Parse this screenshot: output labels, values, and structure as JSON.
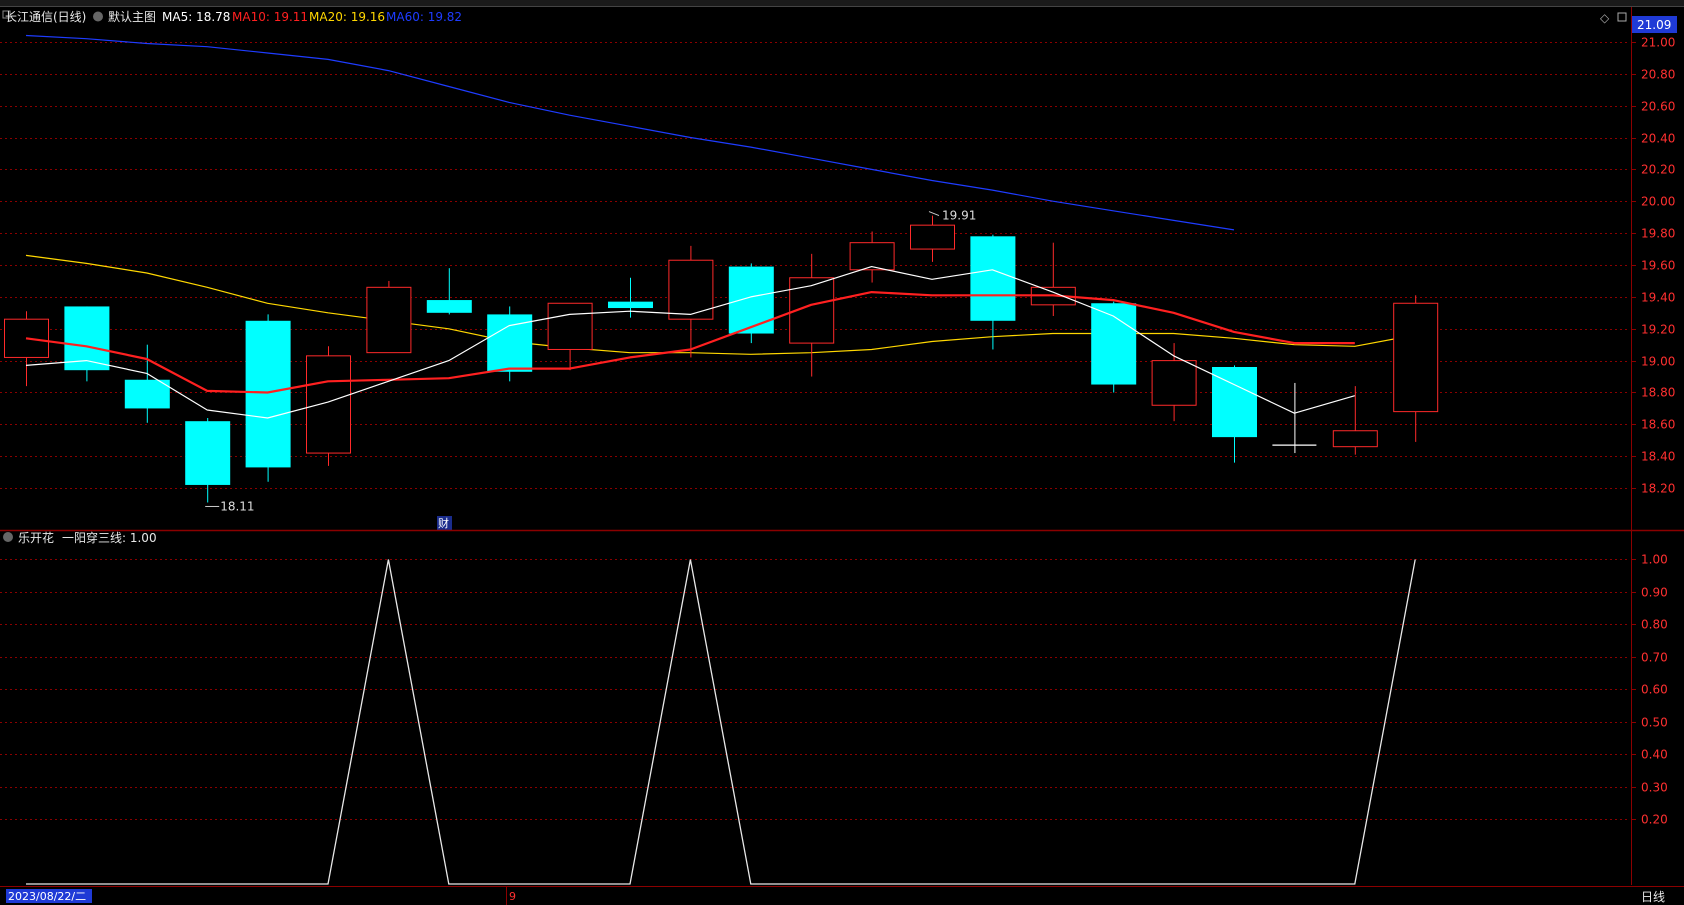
{
  "main_panel": {
    "stock_label": "长江通信(日线)",
    "indicator_label": "默认主图",
    "ma": [
      {
        "label": "MA5: 18.78",
        "color": "#ffffff"
      },
      {
        "label": "MA10: 19.11",
        "color": "#ff2020"
      },
      {
        "label": "MA20: 19.16",
        "color": "#ffd700"
      },
      {
        "label": "MA60: 19.82",
        "color": "#1e3cff"
      }
    ],
    "price_tag": "21.09",
    "high_note": "19.91",
    "low_note": "18.11",
    "event_marker": "财"
  },
  "sub_panel": {
    "label": "乐开花",
    "value_label": "一阳穿三线: 1.00"
  },
  "bottom_bar": {
    "date_cursor": "2023/08/22/二",
    "month_mark": "9",
    "period": "日线"
  },
  "colors": {
    "up": "#ff2a2a",
    "down": "#00ffff",
    "grid": "#8b0000",
    "axis_text": "#ff3030",
    "ma5": "#ffffff",
    "ma10": "#ff2020",
    "ma20": "#ffd700",
    "ma60": "#1e3cff"
  },
  "chart_data": [
    {
      "type": "candlestick",
      "ylim": [
        18.0,
        21.2
      ],
      "yticks": [
        "21.00",
        "20.80",
        "20.60",
        "20.40",
        "20.20",
        "20.00",
        "19.80",
        "19.60",
        "19.40",
        "19.20",
        "19.00",
        "18.80",
        "18.60",
        "18.40",
        "18.20"
      ],
      "yticks_values": [
        21.0,
        20.8,
        20.6,
        20.4,
        20.2,
        20.0,
        19.8,
        19.6,
        19.4,
        19.2,
        19.0,
        18.8,
        18.6,
        18.4,
        18.2
      ],
      "candles": [
        {
          "o": 19.02,
          "c": 19.26,
          "h": 19.31,
          "l": 18.84
        },
        {
          "o": 19.34,
          "c": 18.94,
          "h": 19.34,
          "l": 18.87
        },
        {
          "o": 18.88,
          "c": 18.7,
          "h": 19.1,
          "l": 18.61
        },
        {
          "o": 18.62,
          "c": 18.22,
          "h": 18.64,
          "l": 18.11
        },
        {
          "o": 19.25,
          "c": 18.33,
          "h": 19.29,
          "l": 18.24
        },
        {
          "o": 18.42,
          "c": 19.03,
          "h": 19.09,
          "l": 18.34
        },
        {
          "o": 19.05,
          "c": 19.46,
          "h": 19.5,
          "l": 19.05
        },
        {
          "o": 19.38,
          "c": 19.3,
          "h": 19.58,
          "l": 19.29
        },
        {
          "o": 19.29,
          "c": 18.93,
          "h": 19.34,
          "l": 18.87
        },
        {
          "o": 19.07,
          "c": 19.36,
          "h": 19.36,
          "l": 18.94
        },
        {
          "o": 19.37,
          "c": 19.33,
          "h": 19.52,
          "l": 19.27
        },
        {
          "o": 19.26,
          "c": 19.63,
          "h": 19.72,
          "l": 19.02
        },
        {
          "o": 19.59,
          "c": 19.17,
          "h": 19.61,
          "l": 19.11
        },
        {
          "o": 19.11,
          "c": 19.52,
          "h": 19.67,
          "l": 18.9
        },
        {
          "o": 19.57,
          "c": 19.74,
          "h": 19.81,
          "l": 19.49
        },
        {
          "o": 19.7,
          "c": 19.85,
          "h": 19.91,
          "l": 19.62
        },
        {
          "o": 19.78,
          "c": 19.25,
          "h": 19.79,
          "l": 19.07
        },
        {
          "o": 19.35,
          "c": 19.46,
          "h": 19.74,
          "l": 19.28
        },
        {
          "o": 19.36,
          "c": 18.85,
          "h": 19.37,
          "l": 18.8
        },
        {
          "o": 18.72,
          "c": 19.0,
          "h": 19.11,
          "l": 18.62
        },
        {
          "o": 18.96,
          "c": 18.52,
          "h": 18.97,
          "l": 18.36
        },
        {
          "o": 18.47,
          "c": 18.47,
          "h": 18.86,
          "l": 18.42
        },
        {
          "o": 18.46,
          "c": 18.56,
          "h": 18.84,
          "l": 18.41
        },
        {
          "o": 18.68,
          "c": 19.36,
          "h": 19.41,
          "l": 18.49
        }
      ],
      "ma5": [
        18.97,
        19.0,
        18.92,
        18.69,
        18.64,
        18.74,
        18.87,
        19.0,
        19.22,
        19.29,
        19.31,
        19.29,
        19.4,
        19.47,
        19.59,
        19.51,
        19.57,
        19.43,
        19.28,
        19.03,
        18.85,
        18.67,
        18.78
      ],
      "ma10": [
        19.14,
        19.09,
        19.01,
        18.81,
        18.8,
        18.87,
        18.88,
        18.89,
        18.95,
        18.95,
        19.02,
        19.07,
        19.21,
        19.35,
        19.43,
        19.41,
        19.41,
        19.41,
        19.38,
        19.3,
        19.18,
        19.11,
        19.11
      ],
      "ma20": [
        19.66,
        19.61,
        19.55,
        19.46,
        19.36,
        19.3,
        19.25,
        19.2,
        19.12,
        19.08,
        19.05,
        19.05,
        19.04,
        19.05,
        19.07,
        19.12,
        19.15,
        19.17,
        19.17,
        19.17,
        19.14,
        19.1,
        19.09,
        19.16
      ],
      "ma60": [
        21.04,
        21.02,
        20.99,
        20.97,
        20.93,
        20.89,
        20.82,
        20.72,
        20.62,
        20.54,
        20.47,
        20.4,
        20.34,
        20.27,
        20.2,
        20.13,
        20.07,
        20.0,
        19.94,
        19.88,
        19.82
      ]
    },
    {
      "type": "line",
      "name": "一阳穿三线",
      "ylim": [
        0,
        1.06
      ],
      "yticks": [
        "1.00",
        "0.90",
        "0.80",
        "0.70",
        "0.60",
        "0.50",
        "0.40",
        "0.30",
        "0.20"
      ],
      "yticks_values": [
        1.0,
        0.9,
        0.8,
        0.7,
        0.6,
        0.5,
        0.4,
        0.3,
        0.2
      ],
      "values": [
        0,
        0,
        0,
        0,
        0,
        0,
        1,
        0,
        0,
        0,
        0,
        1,
        0,
        0,
        0,
        0,
        0,
        0,
        0,
        0,
        0,
        0,
        0,
        1
      ]
    }
  ]
}
